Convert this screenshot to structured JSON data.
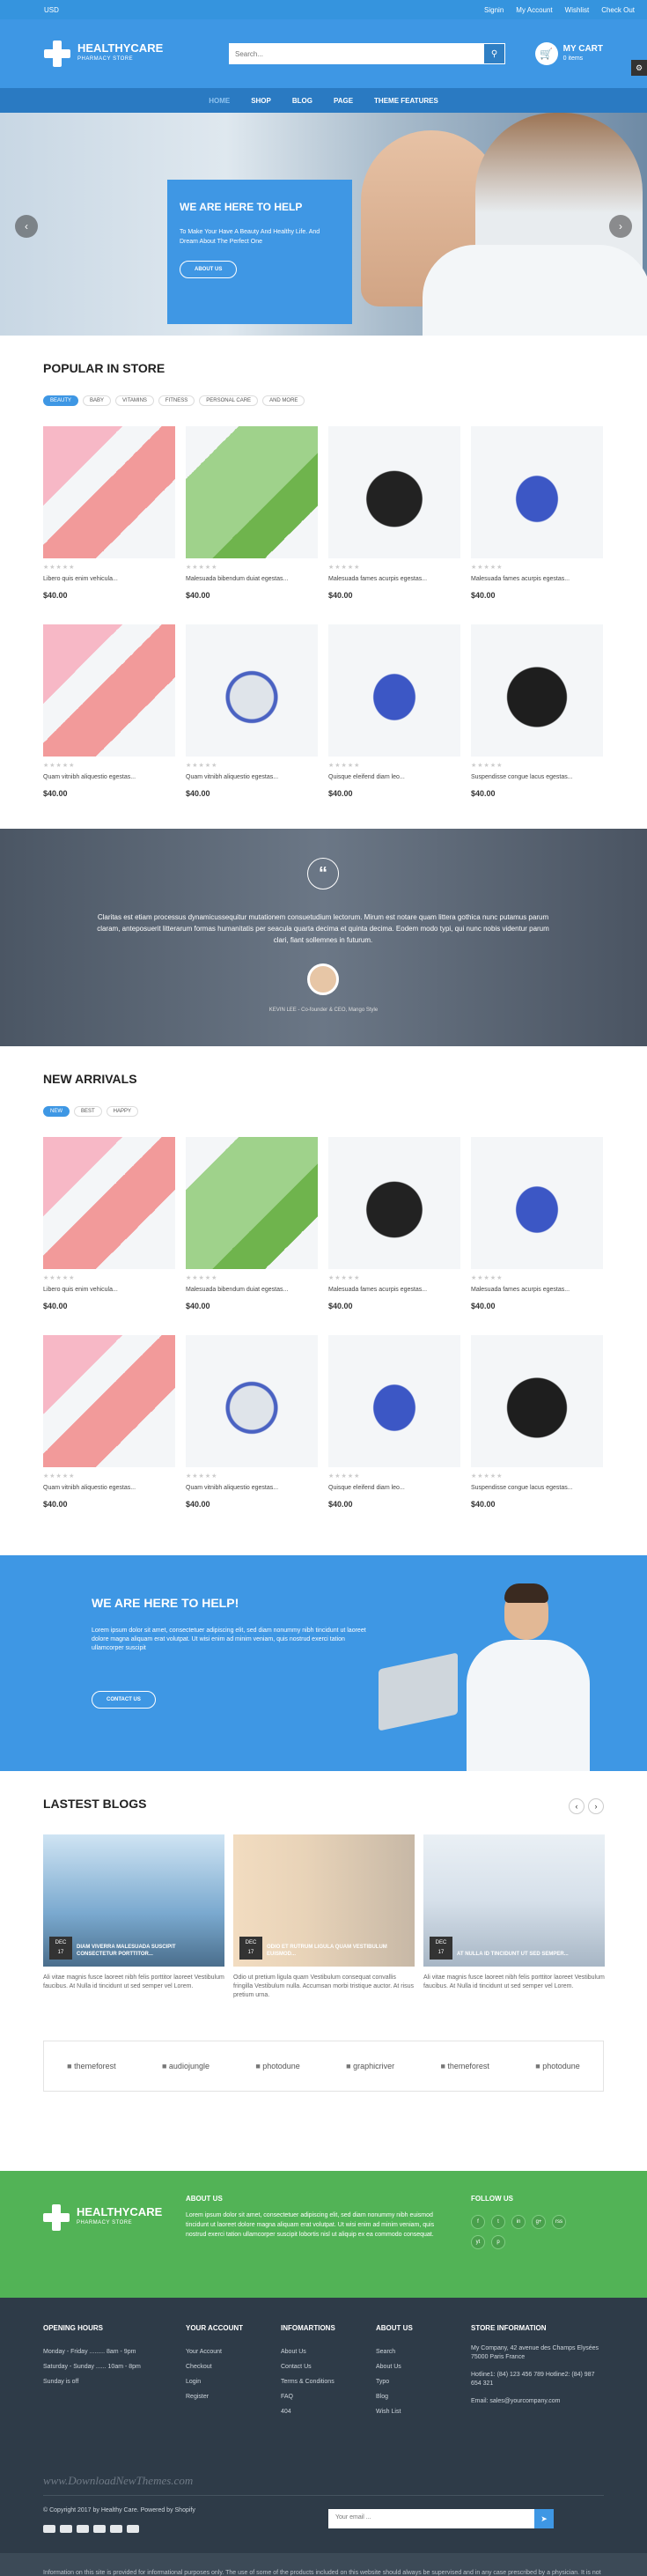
{
  "topbar": {
    "currency": "USD",
    "links": [
      "Signin",
      "My Account",
      "Wishlist",
      "Check Out"
    ]
  },
  "logo": {
    "name": "HEALTHYCARE",
    "tagline": "PHARMACY STORE"
  },
  "search": {
    "placeholder": "Search..."
  },
  "cart": {
    "title": "MY CART",
    "count": "0 items"
  },
  "nav": [
    "HOME",
    "SHOP",
    "BLOG",
    "PAGE",
    "THEME FEATURES"
  ],
  "hero": {
    "title": "WE ARE HERE TO HELP",
    "text": "To Make Your Have A Beauty And Healthy Life. And Dream About The Perfect One",
    "button": "ABOUT US"
  },
  "popular": {
    "title": "POPULAR IN STORE",
    "tabs": [
      "BEAUTY",
      "BABY",
      "VITAMINS",
      "FITNESS",
      "PERSONAL CARE",
      "AND MORE"
    ],
    "products": [
      {
        "name": "Libero quis enim vehicula...",
        "price": "$40.00"
      },
      {
        "name": "Malesuada bibendum duiat egestas...",
        "price": "$40.00"
      },
      {
        "name": "Malesuada fames acurpis egestas...",
        "price": "$40.00"
      },
      {
        "name": "Malesuada fames acurpis egestas...",
        "price": "$40.00"
      },
      {
        "name": "Quam vitnibh aliquestio egestas...",
        "price": "$40.00"
      },
      {
        "name": "Quam vitnibh aliquestio egestas...",
        "price": "$40.00"
      },
      {
        "name": "Quisque eleifend diam leo...",
        "price": "$40.00"
      },
      {
        "name": "Suspendisse congue lacus egestas...",
        "price": "$40.00"
      }
    ]
  },
  "testimonial": {
    "text": "Claritas est etiam processus dynamicussequitur mutationem consuetudium lectorum. Mirum est notare quam littera gothica nunc putamus parum claram, anteposuerit litterarum formas humanitatis per seacula quarta decima et quinta decima. Eodem modo typi, qui nunc nobis videntur parum clari, fiant sollemnes in futurum.",
    "author": "KEVIN LEE - Co-founder & CEO, Mango Style"
  },
  "arrivals": {
    "title": "NEW ARRIVALS",
    "tabs": [
      "NEW",
      "BEST",
      "HAPPY"
    ],
    "products": [
      {
        "name": "Libero quis enim vehicula...",
        "price": "$40.00"
      },
      {
        "name": "Malesuada bibendum duiat egestas...",
        "price": "$40.00"
      },
      {
        "name": "Malesuada fames acurpis egestas...",
        "price": "$40.00"
      },
      {
        "name": "Malesuada fames acurpis egestas...",
        "price": "$40.00"
      },
      {
        "name": "Quam vitnibh aliquestio egestas...",
        "price": "$40.00"
      },
      {
        "name": "Quam vitnibh aliquestio egestas...",
        "price": "$40.00"
      },
      {
        "name": "Quisque eleifend diam leo...",
        "price": "$40.00"
      },
      {
        "name": "Suspendisse congue lacus egestas...",
        "price": "$40.00"
      }
    ]
  },
  "banner": {
    "title": "WE ARE HERE TO HELP!",
    "text": "Lorem ipsum dolor sit amet, consectetuer adipiscing elit, sed diam nonummy nibh tincidunt ut laoreet dolore magna aliquam erat volutpat. Ut wisi enim ad minim veniam, quis nostrud exerci tation ullamcorper suscipit",
    "button": "CONTACT US"
  },
  "blogs": {
    "title": "LASTEST BLOGS",
    "items": [
      {
        "month": "DEC",
        "day": "17",
        "title": "DIAM VIVERRA MALESUADA SUSCIPIT CONSECTETUR PORTTITOR...",
        "text": "Ali vitae magnis fusce laoreet nibh felis porttitor laoreet Vestibulum faucibus. At Nulla id tincidunt ut sed semper vel Lorem."
      },
      {
        "month": "DEC",
        "day": "17",
        "title": "ODIO ET RUTRUM LIGULA QUAM VESTIBULUM EUISMOD...",
        "text": "Odio ut pretium ligula quam Vestibulum consequat convallis fringilla Vestibulum nulla. Accumsan morbi tristique auctor. At risus pretium urna."
      },
      {
        "month": "DEC",
        "day": "17",
        "title": "AT NULLA ID TINCIDUNT UT SED SEMPER...",
        "text": "Ali vitae magnis fusce laoreet nibh felis porttitor laoreet Vestibulum faucibus. At Nulla id tincidunt ut sed semper vel Lorem."
      }
    ]
  },
  "brands": [
    "themeforest",
    "audiojungle",
    "photodune",
    "graphicriver",
    "themeforest",
    "photodune"
  ],
  "green": {
    "about_title": "ABOUT US",
    "about_text": "Lorem ipsum dolor sit amet, consectetuer adipiscing elit, sed diam nonummy nibh euismod tincidunt ut laoreet dolore magna aliquam erat volutpat. Ut wisi enim ad minim veniam, quis nostrud exerci tation ullamcorper suscipit lobortis nisl ut aliquip ex ea commodo consequat.",
    "follow_title": "FOLLOW US",
    "socials": [
      "f",
      "t",
      "in",
      "g+",
      "rss",
      "yt",
      "p"
    ]
  },
  "footer": {
    "hours": {
      "title": "OPENING HOURS",
      "lines": [
        "Monday - Friday ......... 8am - 9pm",
        "Saturday - Sunday ...... 10am - 8pm",
        "Sunday is off"
      ]
    },
    "account": {
      "title": "YOUR ACCOUNT",
      "links": [
        "Your Account",
        "Checkout",
        "Login",
        "Register"
      ]
    },
    "info": {
      "title": "INFOMARTIONS",
      "links": [
        "About Us",
        "Contact Us",
        "Terms & Conditions",
        "FAQ",
        "404"
      ]
    },
    "about": {
      "title": "ABOUT US",
      "links": [
        "Search",
        "About Us",
        "Typo",
        "Blog",
        "Wish List"
      ]
    },
    "store": {
      "title": "STORE INFORMATION",
      "address": "My Company, 42 avenue des Champs Elysées 75000 Paris France",
      "phone": "Hotline1: (84) 123 456 789 Hotline2: (84) 987 654 321",
      "email": "Email: sales@yourcompany.com"
    },
    "watermark": "www.DownloadNewThemes.com",
    "copyright": "© Copyright 2017 by Healthy Care. Powered by Shopify",
    "newsletter_placeholder": "Your email ...",
    "disclaimer": "Information on this site is provided for informational purposes only. The use of some of the products included on this website should always be supervised and in any case prescribed by a physician. It is not meant to substitute for the advice provided by your own physician or other medical professional. If you have or suspect that you have a medical problem, promptly contact your health care provider. The products must be used according to the information provided by manufacturers printed in brochures and on the packaging of the products. You should carefully read all product packaging, and contact the manufacturer with any questions before using a product."
  }
}
